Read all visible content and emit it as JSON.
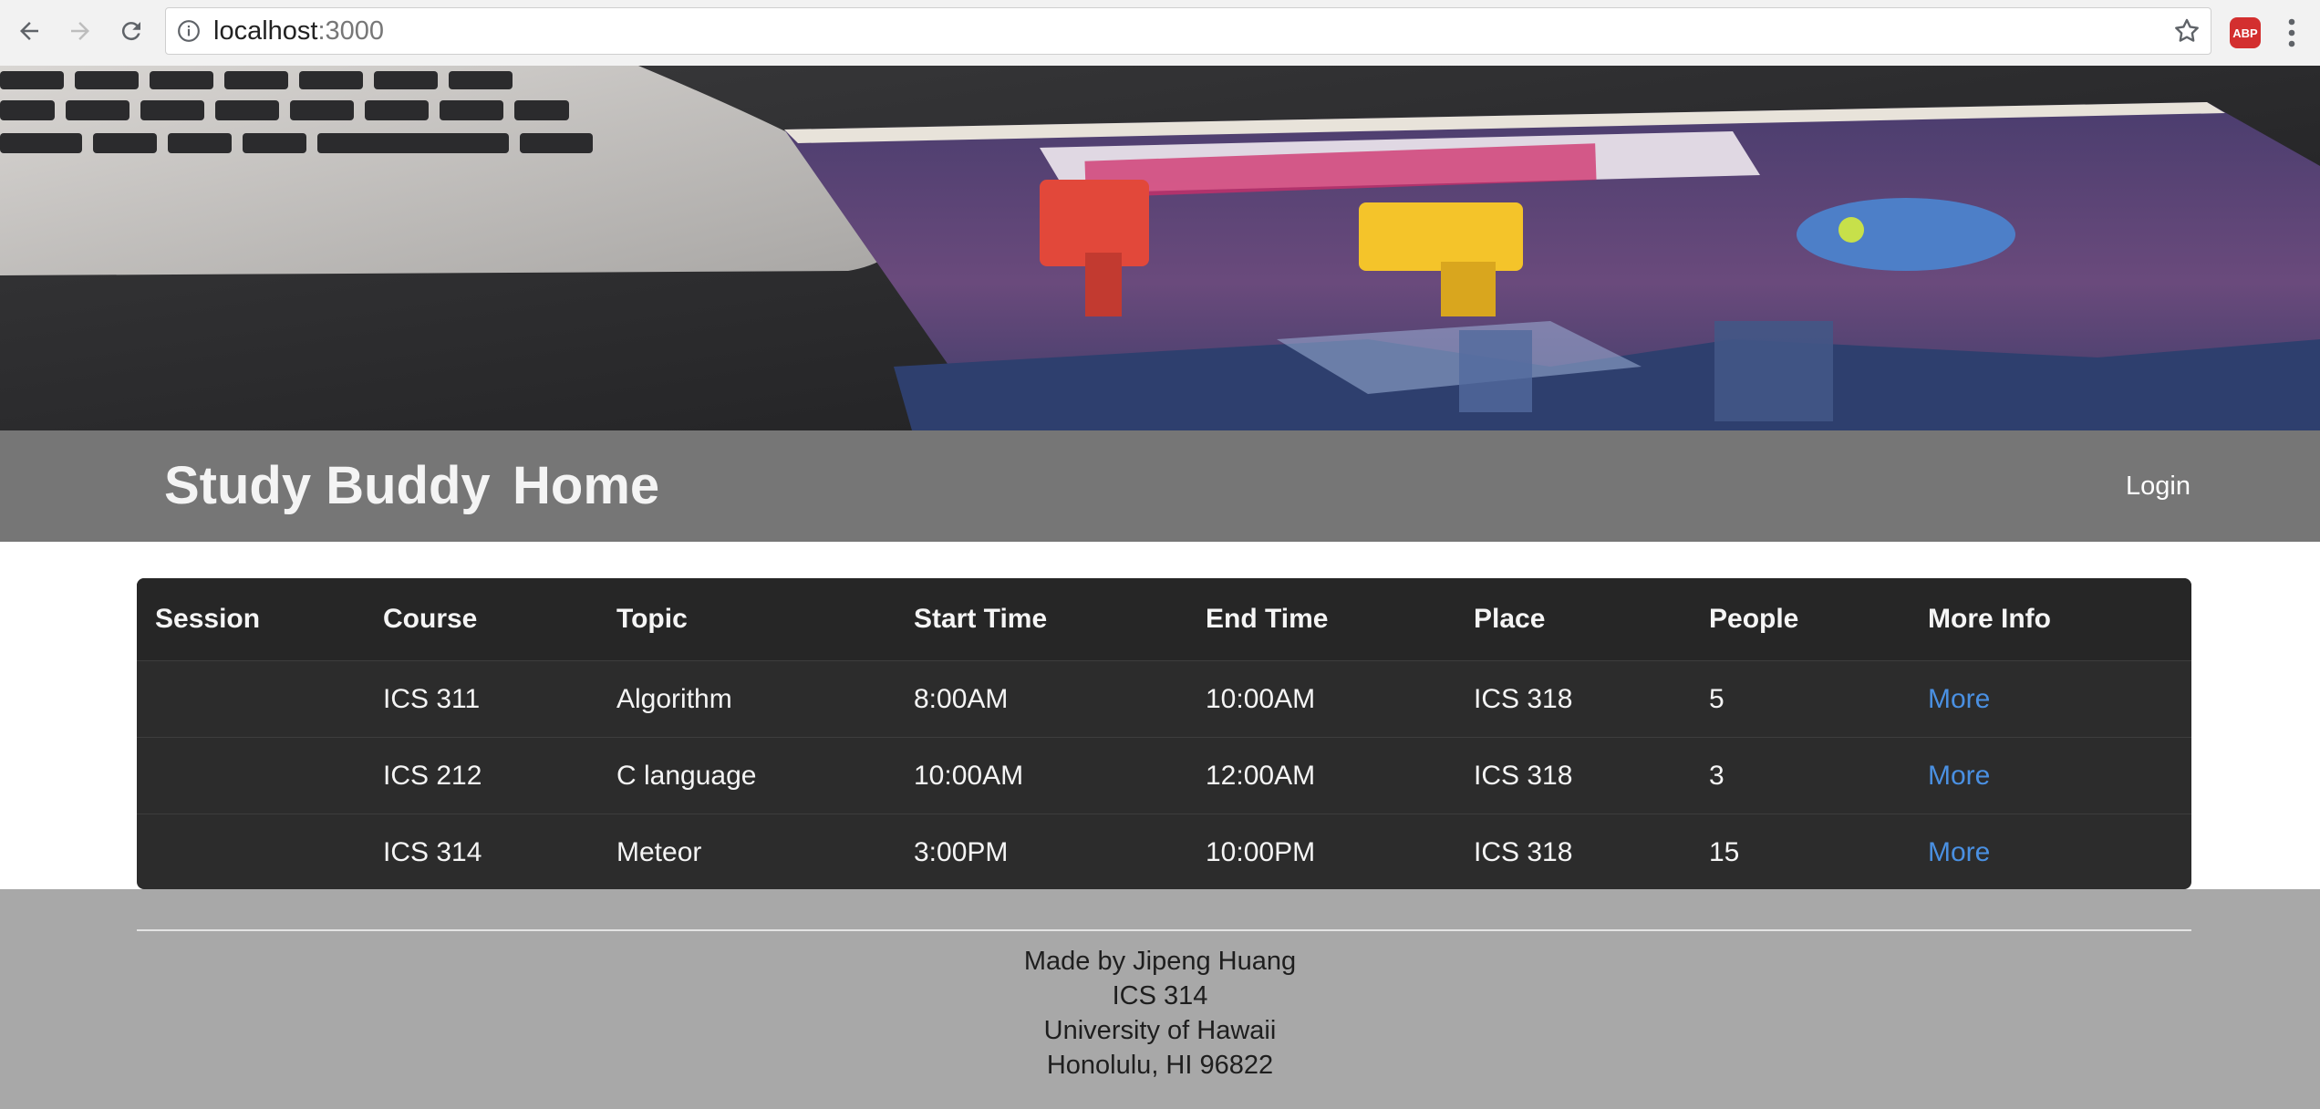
{
  "browser": {
    "url_host": "localhost",
    "url_port": ":3000",
    "adblock_label": "ABP"
  },
  "navbar": {
    "brand": "Study Buddy",
    "home": "Home",
    "login": "Login"
  },
  "table": {
    "headers": [
      "Session",
      "Course",
      "Topic",
      "Start Time",
      "End Time",
      "Place",
      "People",
      "More Info"
    ],
    "rows": [
      {
        "session": "",
        "course": "ICS 311",
        "topic": "Algorithm",
        "start": "8:00AM",
        "end": "10:00AM",
        "place": "ICS 318",
        "people": "5",
        "more": "More"
      },
      {
        "session": "",
        "course": "ICS 212",
        "topic": "C language",
        "start": "10:00AM",
        "end": "12:00AM",
        "place": "ICS 318",
        "people": "3",
        "more": "More"
      },
      {
        "session": "",
        "course": "ICS 314",
        "topic": "Meteor",
        "start": "3:00PM",
        "end": "10:00PM",
        "place": "ICS 318",
        "people": "15",
        "more": "More"
      }
    ]
  },
  "footer": {
    "lines": [
      "Made by Jipeng Huang",
      "ICS 314",
      "University of Hawaii",
      "Honolulu, HI 96822"
    ]
  },
  "colors": {
    "menubar": "#767676",
    "table_bg": "#2c2c2c",
    "link": "#4a90e2",
    "footer_bg": "#a8a8a8"
  },
  "icons": {
    "back": "arrow-left-icon",
    "forward": "arrow-right-icon",
    "reload": "reload-icon",
    "info": "info-icon",
    "bookmark": "star-icon",
    "menu": "kebab-menu-icon"
  }
}
